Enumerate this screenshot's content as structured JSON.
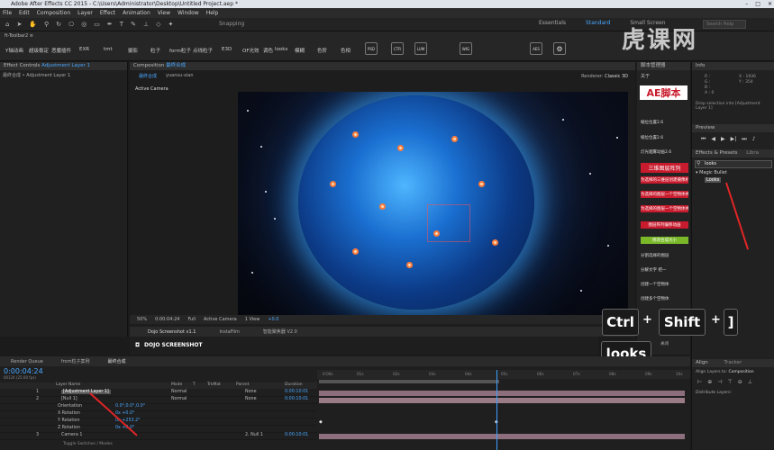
{
  "window": {
    "title": "Adobe After Effects CC 2015 - C:\\Users\\Administrator\\Desktop\\Untitled Project.aep *"
  },
  "menu": [
    "File",
    "Edit",
    "Composition",
    "Layer",
    "Effect",
    "Animation",
    "View",
    "Window",
    "Help"
  ],
  "toolbar": {
    "snapping_label": "Snapping",
    "workspaces": [
      "Essentials",
      "Standard",
      "Small Screen"
    ],
    "search_placeholder": "Search Help"
  },
  "toolbar2": {
    "title": "ft-Toolbar2 ≡",
    "items": [
      "Y轴动画",
      "超级稳定",
      "恶魔插件",
      "EXR",
      "tmt",
      "摄影",
      "粒子",
      "form粒子",
      "点线粒子",
      "E3D",
      "OF光效",
      "调色",
      "looks",
      "模糊",
      "色阶",
      "色相"
    ],
    "box_items": [
      "PSD",
      "CTR",
      "LUM",
      "WIG",
      "AES"
    ]
  },
  "effect_controls": {
    "title": "Effect Controls",
    "target": "Adjustment Layer 1",
    "breadcrumb": "最终合成 • Adjustment Layer 1"
  },
  "composition": {
    "panel_title": "Composition",
    "comp_name": "最终合成",
    "tabs": [
      "最终合成",
      "yuansu-xian"
    ],
    "renderer_label": "Renderer:",
    "renderer_value": "Classic 3D",
    "active_camera": "Active Camera",
    "viewer_bar": [
      "50%",
      "0:00:04:24",
      "Full",
      "Active Camera",
      "1 View",
      "+0.0"
    ]
  },
  "dojo": {
    "tabs": [
      "Dojo Screenshot v1.1",
      "InstaFilm",
      "智能聚焦器 V2.0"
    ],
    "brand": "DOJO SCREENSHOT"
  },
  "script_manager": {
    "title": "脚本管理器",
    "about": "关于",
    "heading": "AE脚本",
    "items": [
      "缩位位置2.6",
      "缩位位置2.6",
      "灯光烟雾动画2.6",
      "三维图层阵列",
      "为选择的三维层创建摄像机",
      "为选择的图层一个空物体并父子链接",
      "为选择的图层一个空物体并父子链接",
      "图层阵列偏移动画",
      "修改合成大小",
      "分割选择的图层",
      "分解文字 把一",
      "创建一个空物体",
      "创建多个空物体"
    ],
    "close": "关闭"
  },
  "info": {
    "title": "Info",
    "r": "R :",
    "g": "G :",
    "b": "B :",
    "a": "A : 0",
    "x": "X : 1936",
    "y": "Y : 354",
    "hint": "Drop selection into [Adjustment Layer 1]"
  },
  "preview": {
    "title": "Preview"
  },
  "effects_presets": {
    "title": "Effects & Presets",
    "libraries": "Libra",
    "search_value": "looks",
    "folder": "Magic Bullet",
    "result": "Looks"
  },
  "shortcut": {
    "keys": [
      "Ctrl",
      "Shift",
      "]"
    ],
    "plus": "+",
    "caption": "looks"
  },
  "watermark": "虎课网",
  "timeline": {
    "tabs": [
      "Render Queue",
      "from粒子案例",
      "最终合成"
    ],
    "timecode": "0:00:04:24",
    "fps": "00124 (25.00 fps)",
    "columns": [
      "Layer Name",
      "Mode",
      "T",
      "TrkMat",
      "Parent",
      "Duration"
    ],
    "layers": [
      {
        "num": "1",
        "name": "[Adjustment Layer 1]",
        "mode": "Normal",
        "parent": "None",
        "duration": "0:00:10:01"
      },
      {
        "num": "2",
        "name": "[Null 1]",
        "mode": "Normal",
        "parent": "None",
        "duration": "0:00:10:01"
      },
      {
        "num": "",
        "name": "Orientation",
        "mode": "0.0°,0.0°,0.0°",
        "parent": "",
        "duration": ""
      },
      {
        "num": "",
        "name": "X Rotation",
        "mode": "0x +0.0°",
        "parent": "",
        "duration": ""
      },
      {
        "num": "",
        "name": "Y Rotation",
        "mode": "0x +253.2°",
        "parent": "",
        "duration": ""
      },
      {
        "num": "",
        "name": "Z Rotation",
        "mode": "0x +0.0°",
        "parent": "",
        "duration": ""
      },
      {
        "num": "3",
        "name": "Camera 1",
        "mode": "",
        "parent": "2. Null 1",
        "duration": "0:00:10:01"
      }
    ],
    "ruler": [
      "0:00s",
      "01s",
      "02s",
      "03s",
      "04s",
      "05s",
      "06s",
      "07s",
      "08s",
      "09s",
      "10s"
    ],
    "toggle_label": "Toggle Switches / Modes"
  },
  "align": {
    "title": "Align",
    "tracker": "Tracker",
    "align_to_label": "Align Layers to:",
    "align_to_value": "Composition",
    "distribute_label": "Distribute Layers:"
  },
  "colors": {
    "accent_blue": "#3aa0ff",
    "script_red": "#c81b2d",
    "script_green": "#7ab82a",
    "annotation_red": "#e02525"
  }
}
